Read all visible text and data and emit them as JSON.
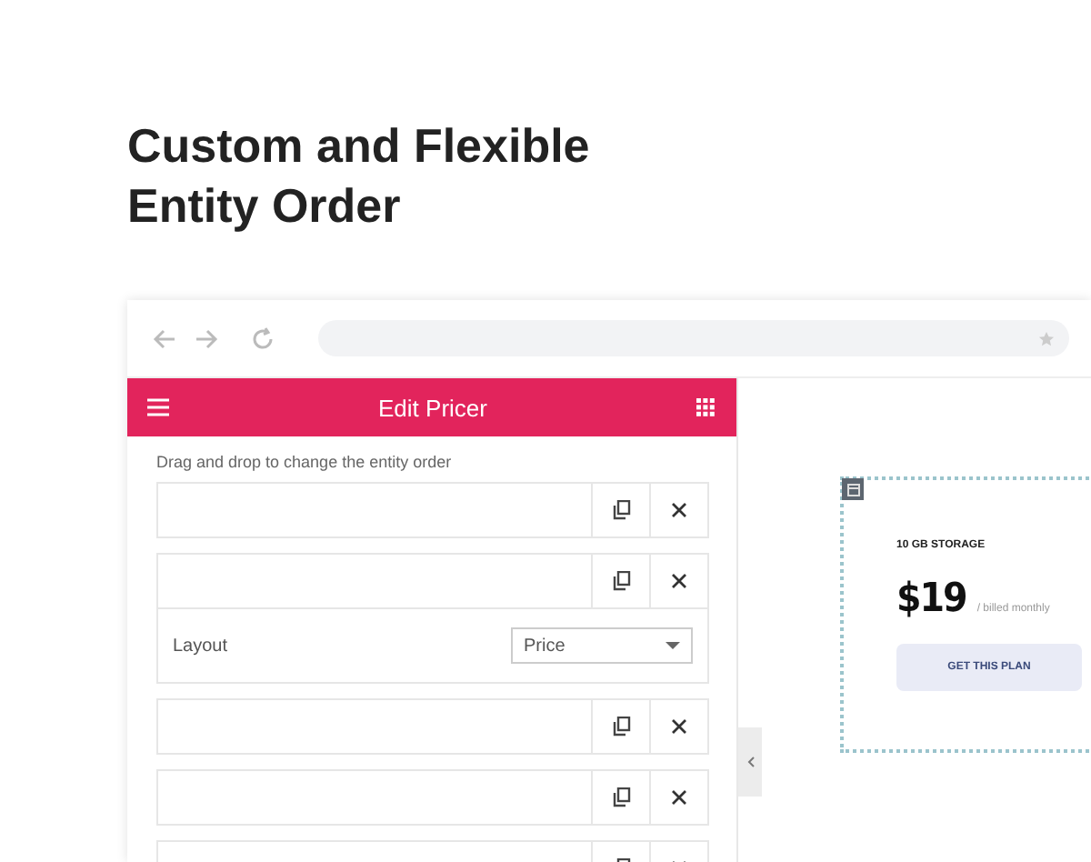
{
  "heading": "Custom and Flexible Entity Order",
  "panel": {
    "title": "Edit Pricer",
    "hint": "Drag and drop to change the entity order",
    "entities": [
      {
        "expanded": false
      },
      {
        "expanded": true,
        "setting_label": "Layout",
        "setting_value": "Price"
      },
      {
        "expanded": false
      },
      {
        "expanded": false
      },
      {
        "expanded": false
      }
    ]
  },
  "preview": {
    "title": "10 GB STORAGE",
    "price": "$19",
    "period": "/ billed monthly",
    "button": "GET THIS PLAN"
  }
}
